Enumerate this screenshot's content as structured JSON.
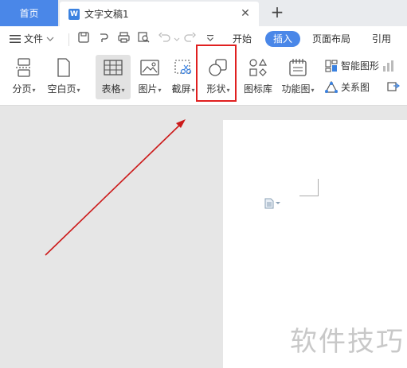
{
  "tabs": {
    "home": "首页",
    "doc_icon": "W",
    "doc_title": "文字文稿1",
    "close_glyph": "✕",
    "new_glyph": "+"
  },
  "menu": {
    "file_label": "文件",
    "tabs": [
      "开始",
      "插入",
      "页面布局",
      "引用"
    ],
    "active_tab": "插入"
  },
  "ribbon": {
    "page_break": "分页",
    "blank_page": "空白页",
    "table": "表格",
    "picture": "图片",
    "screenshot": "截屏",
    "shape": "形状",
    "icon_library": "图标库",
    "function_chart": "功能图",
    "smart_graphic": "智能图形",
    "relation_chart": "关系图"
  },
  "watermark": "软件技巧",
  "colors": {
    "accent": "#4a87e8",
    "highlight": "#e02020",
    "arrow": "#cc1a1a"
  }
}
